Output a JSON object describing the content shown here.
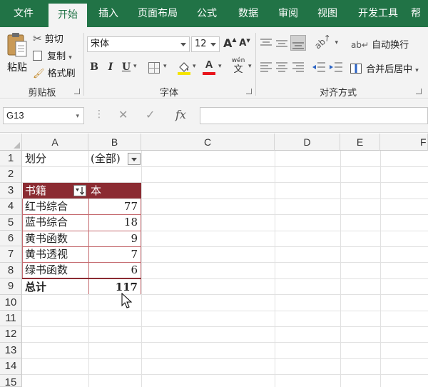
{
  "ribbon_tabs": [
    "文件",
    "开始",
    "插入",
    "页面布局",
    "公式",
    "数据",
    "审阅",
    "视图",
    "开发工具",
    "帮"
  ],
  "active_tab": "开始",
  "clipboard": {
    "paste": "粘贴",
    "cut": "剪切",
    "copy": "复制",
    "format_painter": "格式刷",
    "group_label": "剪贴板"
  },
  "font": {
    "name": "宋体",
    "size": "12",
    "bold": "B",
    "italic": "I",
    "underline": "U",
    "grow": "A",
    "shrink": "A",
    "phonetic_top": "wén",
    "phonetic_bottom": "文",
    "group_label": "字体"
  },
  "alignment": {
    "wrap_text": "自动换行",
    "merge_center": "合并后居中",
    "group_label": "对齐方式"
  },
  "formula_bar": {
    "name_box": "G13",
    "formula": "",
    "fx": "fx"
  },
  "columns": [
    "A",
    "B",
    "C",
    "D",
    "E",
    "F"
  ],
  "rows": [
    "1",
    "2",
    "3",
    "4",
    "5",
    "6",
    "7",
    "8",
    "9",
    "10",
    "11",
    "12",
    "13",
    "14",
    "15"
  ],
  "cells": {
    "filter_label": "划分",
    "filter_value": "(全部)",
    "header_row": "书籍",
    "header_value": "本",
    "items": [
      {
        "label": "红书综合",
        "value": "77"
      },
      {
        "label": "蓝书综合",
        "value": "18"
      },
      {
        "label": "黄书函数",
        "value": "9"
      },
      {
        "label": "黄书透视",
        "value": "7"
      },
      {
        "label": "绿书函数",
        "value": "6"
      }
    ],
    "total_label": "总计",
    "total_value": "117"
  },
  "colors": {
    "brand": "#217346",
    "pivot_header": "#8b2b32",
    "highlight": "#f5e400",
    "font_red": "#e8141b"
  }
}
